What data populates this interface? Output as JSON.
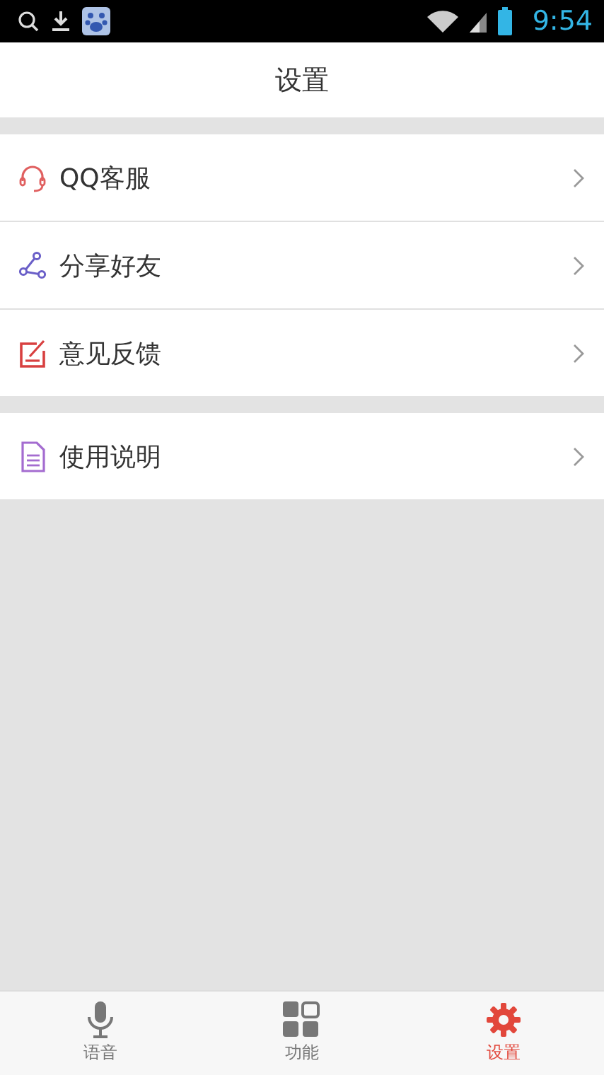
{
  "status_bar": {
    "time": "9:54"
  },
  "header": {
    "title": "设置"
  },
  "groups": [
    {
      "items": [
        {
          "kind": "headset",
          "label": "QQ客服"
        },
        {
          "kind": "share",
          "label": "分享好友"
        },
        {
          "kind": "feedback",
          "label": "意见反馈"
        }
      ]
    },
    {
      "items": [
        {
          "kind": "document",
          "label": "使用说明"
        }
      ]
    }
  ],
  "tabs": [
    {
      "kind": "voice",
      "label": "语音",
      "selected": false
    },
    {
      "kind": "functions",
      "label": "功能",
      "selected": false
    },
    {
      "kind": "settings",
      "label": "设置",
      "selected": true
    }
  ]
}
